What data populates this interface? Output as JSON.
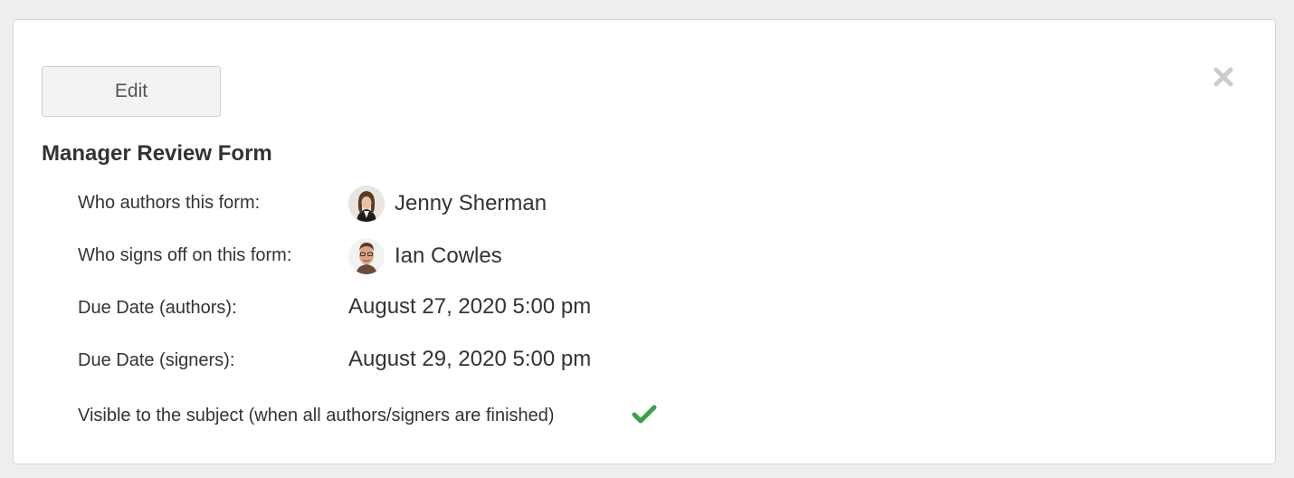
{
  "panel": {
    "edit_label": "Edit",
    "close_icon": "close-icon",
    "title": "Manager Review Form"
  },
  "fields": {
    "authors_label": "Who authors this form:",
    "authors_value": "Jenny Sherman",
    "signers_label": "Who signs off on this form:",
    "signers_value": "Ian Cowles",
    "due_authors_label": "Due Date (authors):",
    "due_authors_value": "August 27, 2020 5:00 pm",
    "due_signers_label": "Due Date (signers):",
    "due_signers_value": "August 29, 2020 5:00 pm",
    "visible_label": "Visible to the subject (when all authors/signers are finished)",
    "visible_icon": "checkmark-icon"
  },
  "colors": {
    "check": "#3aa14a",
    "close": "#cccccc",
    "background": "#eeeeee"
  }
}
